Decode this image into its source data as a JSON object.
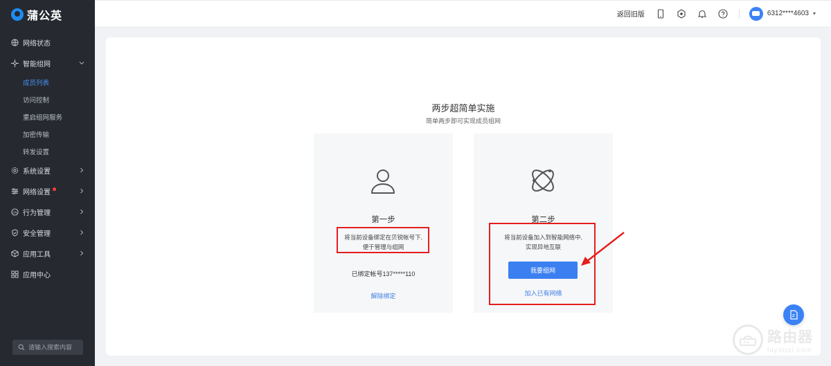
{
  "app": {
    "name": "蒲公英"
  },
  "sidebar": {
    "items": [
      {
        "label": "网络状态"
      },
      {
        "label": "智能组网"
      },
      {
        "label": "系统设置"
      },
      {
        "label": "网络设置"
      },
      {
        "label": "行为管理"
      },
      {
        "label": "安全管理"
      },
      {
        "label": "应用工具"
      },
      {
        "label": "应用中心"
      }
    ],
    "sub_items": [
      {
        "label": "成员列表",
        "active": true
      },
      {
        "label": "访问控制"
      },
      {
        "label": "重启组网服务"
      },
      {
        "label": "加密传输"
      },
      {
        "label": "转发设置"
      }
    ],
    "search_placeholder": "请输入搜索内容"
  },
  "topbar": {
    "back_link": "返回旧版",
    "icons": [
      "mobile-icon",
      "plugin-icon",
      "bell-icon",
      "help-icon"
    ],
    "user": "6312****4603"
  },
  "main": {
    "title": "两步超简单实施",
    "subtitle": "简单两步即可实现成员组网",
    "step1": {
      "title": "第一步",
      "desc_line1": "将当前设备绑定在贝锐帐号下,",
      "desc_line2": "便于管理与组网",
      "bound_text": "已绑定帐号137*****110",
      "link": "解除绑定"
    },
    "step2": {
      "title": "第二步",
      "desc_line1": "将当前设备加入到智能网络中,",
      "desc_line2": "实现异地互联",
      "button": "我要组网",
      "link": "加入已有网络"
    }
  },
  "watermark": {
    "text": "路由器",
    "url_text": "luyouqi.com"
  },
  "colors": {
    "accent": "#3b7ff0",
    "sidebar_bg": "#262a30",
    "highlight": "#e51d1d"
  }
}
